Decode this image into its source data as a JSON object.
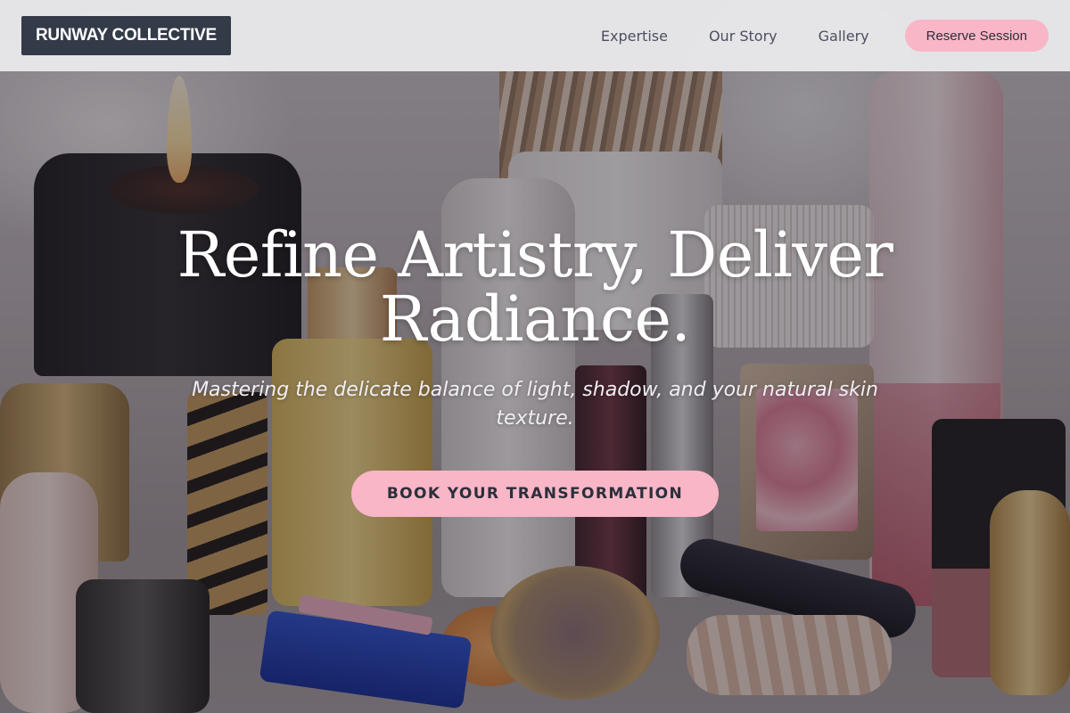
{
  "header": {
    "brand": "RUNWAY COLLECTIVE",
    "nav": [
      {
        "label": "Expertise"
      },
      {
        "label": "Our Story"
      },
      {
        "label": "Gallery"
      }
    ],
    "cta_label": "Reserve Session"
  },
  "hero": {
    "title": "Refine Artistry, Deliver Radiance.",
    "subtitle": "Mastering the delicate balance of light, shadow, and your natural skin texture.",
    "cta_label": "BOOK YOUR TRANSFORMATION",
    "background_icon": "makeup-products-photo"
  },
  "colors": {
    "accent": "#f9b6c7",
    "logo_bg": "#333a48",
    "header_bg": "#ececee",
    "nav_text": "#4a5060"
  }
}
